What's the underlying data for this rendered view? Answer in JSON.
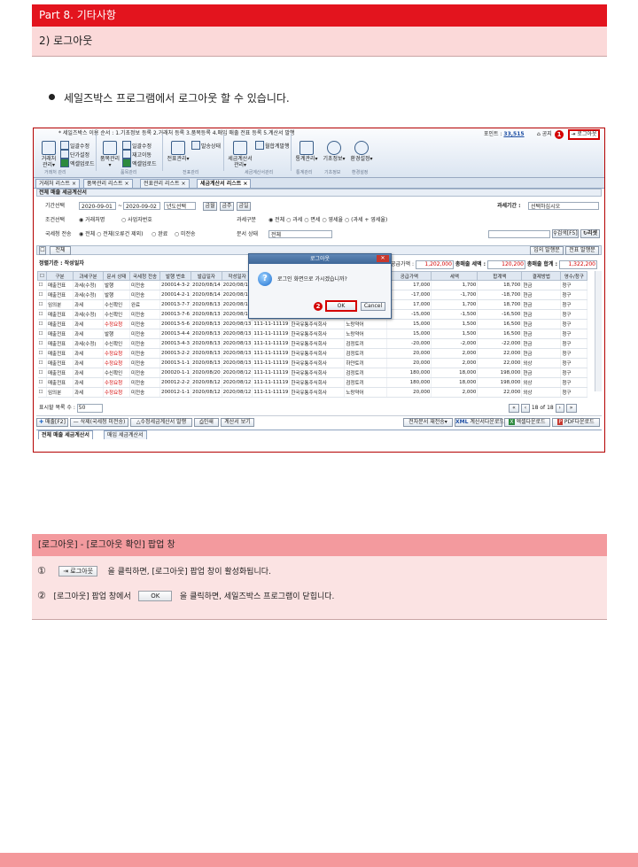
{
  "page": {
    "part_title": "Part 8. 기타사항",
    "section_title": "2) 로그아웃",
    "bullet_text": "세일즈박스 프로그램에서 로그아웃 할 수 있습니다."
  },
  "screenshot": {
    "top_notice": "* 세일즈박스 이용 순서 : 1.기초정보 등록 2.거래처 등록 3.품목등록 4.매입 매출 전표 등록 5.계산서 발행",
    "point_label": "포인트 :",
    "point_value": "33,515",
    "logout_button": "로그아웃",
    "notice_button": "공지",
    "ribbon": {
      "client_btn": "거래처\n관리",
      "regist_btn": "일괄수정",
      "entry_btn": "단가설정",
      "excel_upload_btn": "엑셀업로드",
      "item_btn": "품목관리",
      "item_regist_btn": "일괄수정",
      "stock_btn": "재고이동",
      "item_excel_btn": "엑셀업로드",
      "slip_btn": "전표관리",
      "slip_status_btn": "발송상태",
      "tax_btn": "세금계산서\n관리",
      "tax_issue_btn": "월합계발행",
      "stats_btn": "통계관리",
      "info_btn": "기초정보",
      "settings_btn": "환경설정",
      "group_client": "거래처 관리",
      "group_item": "품목관리",
      "group_slip": "전표관리",
      "group_tax": "세금계산서관리",
      "group_stats": "통계관리",
      "group_info": "기초정보",
      "group_settings": "환경설정"
    },
    "tabs": [
      "거래처 리스트",
      "품목관리 리스트",
      "전표관리 리스트",
      "세금계산서 리스트"
    ],
    "panel_title": "전체 매출 세금계산서",
    "form": {
      "period_label": "기간선택",
      "date_from": "2020-09-01",
      "date_to": "2020-09-02",
      "year_select": "년도선택",
      "btn_today": "금월",
      "btn_prev": "금주",
      "btn_week": "금일",
      "tax_period_label": "과세기간 :",
      "tax_period_value": "선택하십시오",
      "cond_label": "조건선택",
      "cond_opt1": "거래처명",
      "cond_opt2": "사업자번호",
      "tax_type_label": "과세구분",
      "tax_type_opts": [
        "전체",
        "과세",
        "면세",
        "영세율",
        "(과세 + 영세율)"
      ],
      "nts_label": "국세청 전송",
      "nts_opts": [
        "전체",
        "전체(오류건 제외)",
        "완료",
        "미전송"
      ],
      "doc_state_label": "문서 상태",
      "doc_state_value": "전체",
      "search_btn": "검색[F5]",
      "reset_btn": "리셋"
    },
    "total_tab": "전체",
    "btn_fake_issue": "임의 발행분",
    "btn_batch_issue": "전표 발행분",
    "sort_label": "정렬기준 : 작성일자",
    "sum_label_1": "공급가액 :",
    "sum_value_1": "1,202,000",
    "sum_label_2": "총매출 세액 :",
    "sum_value_2": "120,200",
    "sum_label_3": "총매출 합계 :",
    "sum_value_3": "1,322,200",
    "grid": {
      "headers": [
        "구분",
        "과세구분",
        "문서 상태",
        "국세청 전송",
        "발행 번호",
        "발급일자",
        "작성일자",
        "등록번호",
        "상호",
        "품목",
        "공급가액",
        "세액",
        "합계액",
        "결제방법",
        "영수/청구"
      ],
      "rows": [
        [
          "매출전표",
          "과세(수정)",
          "발행",
          "미전송",
          "200014-3-2",
          "2020/08/14",
          "2020/08/13",
          "",
          "",
          "",
          "17,000",
          "1,700",
          "18,700",
          "현금",
          "청구"
        ],
        [
          "매출전표",
          "과세(수정)",
          "발행",
          "미전송",
          "200014-2-1",
          "2020/08/14",
          "2020/08/13",
          "",
          "",
          "",
          "-17,000",
          "-1,700",
          "-18,700",
          "현금",
          "청구"
        ],
        [
          "임의분",
          "과세",
          "수신확인",
          "완료",
          "200013-7-7",
          "2020/08/13",
          "2020/08/13",
          "",
          "",
          "",
          "17,000",
          "1,700",
          "18,700",
          "현금",
          "청구"
        ],
        [
          "매출전표",
          "과세(수정)",
          "수신확인",
          "미전송",
          "200013-7-6",
          "2020/08/13",
          "2020/08/13",
          "",
          "",
          "",
          "-15,000",
          "-1,500",
          "-16,500",
          "현금",
          "청구"
        ],
        [
          "매출전표",
          "과세",
          "수정요청",
          "미전송",
          "200013-5-6",
          "2020/08/13",
          "2020/08/13",
          "111-11-11119",
          "한국유통주식회사",
          "노랑약어",
          "15,000",
          "1,500",
          "16,500",
          "현금",
          "청구"
        ],
        [
          "매출전표",
          "과세",
          "발행",
          "미전송",
          "200013-4-4",
          "2020/08/13",
          "2020/08/13",
          "111-11-11119",
          "한국유통주식회사",
          "노랑약어",
          "15,000",
          "1,500",
          "16,500",
          "현금",
          "청구"
        ],
        [
          "매출전표",
          "과세(수정)",
          "수신확인",
          "미전송",
          "200013-4-3",
          "2020/08/13",
          "2020/08/13",
          "111-11-11119",
          "한국유통주식회사",
          "검정토끼",
          "-20,000",
          "-2,000",
          "-22,000",
          "현금",
          "청구"
        ],
        [
          "매출전표",
          "과세",
          "수정요청",
          "미전송",
          "200013-2-2",
          "2020/08/13",
          "2020/08/13",
          "111-11-11119",
          "한국유통주식회사",
          "검정토끼",
          "20,000",
          "2,000",
          "22,000",
          "현금",
          "청구"
        ],
        [
          "매출전표",
          "과세",
          "수정요청",
          "미전송",
          "200013-1-1",
          "2020/08/13",
          "2020/08/13",
          "111-11-11119",
          "한국유통주식회사",
          "하얀토끼",
          "20,000",
          "2,000",
          "22,000",
          "외상",
          "청구"
        ],
        [
          "매출전표",
          "과세",
          "수신확인",
          "미전송",
          "200020-1-1",
          "2020/08/20",
          "2020/08/12",
          "111-11-11119",
          "한국유통주식회사",
          "검정토끼",
          "180,000",
          "18,000",
          "198,000",
          "현금",
          "청구"
        ],
        [
          "매출전표",
          "과세",
          "수정요청",
          "미전송",
          "200012-2-2",
          "2020/08/12",
          "2020/08/12",
          "111-11-11119",
          "한국유통주식회사",
          "검정토끼",
          "180,000",
          "18,000",
          "198,000",
          "외상",
          "청구"
        ],
        [
          "임의분",
          "과세",
          "수정요청",
          "미전송",
          "200012-1-1",
          "2020/08/12",
          "2020/08/12",
          "111-11-11119",
          "한국유통주식회사",
          "노랑약어",
          "20,000",
          "2,000",
          "22,000",
          "외상",
          "청구"
        ]
      ],
      "red_status": "수정요청"
    },
    "page_size_label": "표시할 목록 수 :",
    "page_size_value": "50",
    "pagination": "18 of 18",
    "bottom_buttons": {
      "sale": "매출[F2]",
      "delete": "삭제(국세청 미전송)",
      "modify_issue": "수정세금계산서 발행",
      "print": "인쇄",
      "view": "계산서 보기",
      "resend": "전자문서 재전송",
      "xml_download": "계산서다운로드",
      "excel_download": "엑셀다운로드",
      "pdf_download": "PDF다운로드"
    },
    "bottom_tabs": [
      "전체 매출 세금계산서",
      "매입 세금계산서"
    ],
    "dialog": {
      "title": "로그아웃",
      "message": "로그인 화면으로 가시겠습니까?",
      "ok": "OK",
      "cancel": "Cancel"
    },
    "badge_1": "1",
    "badge_2": "2"
  },
  "instructions": {
    "title": "[로그아웃] - [로그아웃 확인] 팝업 창",
    "step1_num": "①",
    "step1_btn": "로그아웃",
    "step1_text": "을 클릭하면, [로그아웃] 팝업 창이 활성화됩니다.",
    "step2_num": "②",
    "step2_pre": "[로그아웃] 팝업 창에서",
    "step2_btn": "OK",
    "step2_text": "을 클릭하면, 세일즈박스 프로그램이 닫힙니다."
  },
  "colors": {
    "part_header": "#e3141e",
    "section_bg": "#fbd9d9",
    "instr_header": "#f39a9e",
    "instr_body": "#fbe3e3",
    "highlight_red": "#d40000"
  }
}
